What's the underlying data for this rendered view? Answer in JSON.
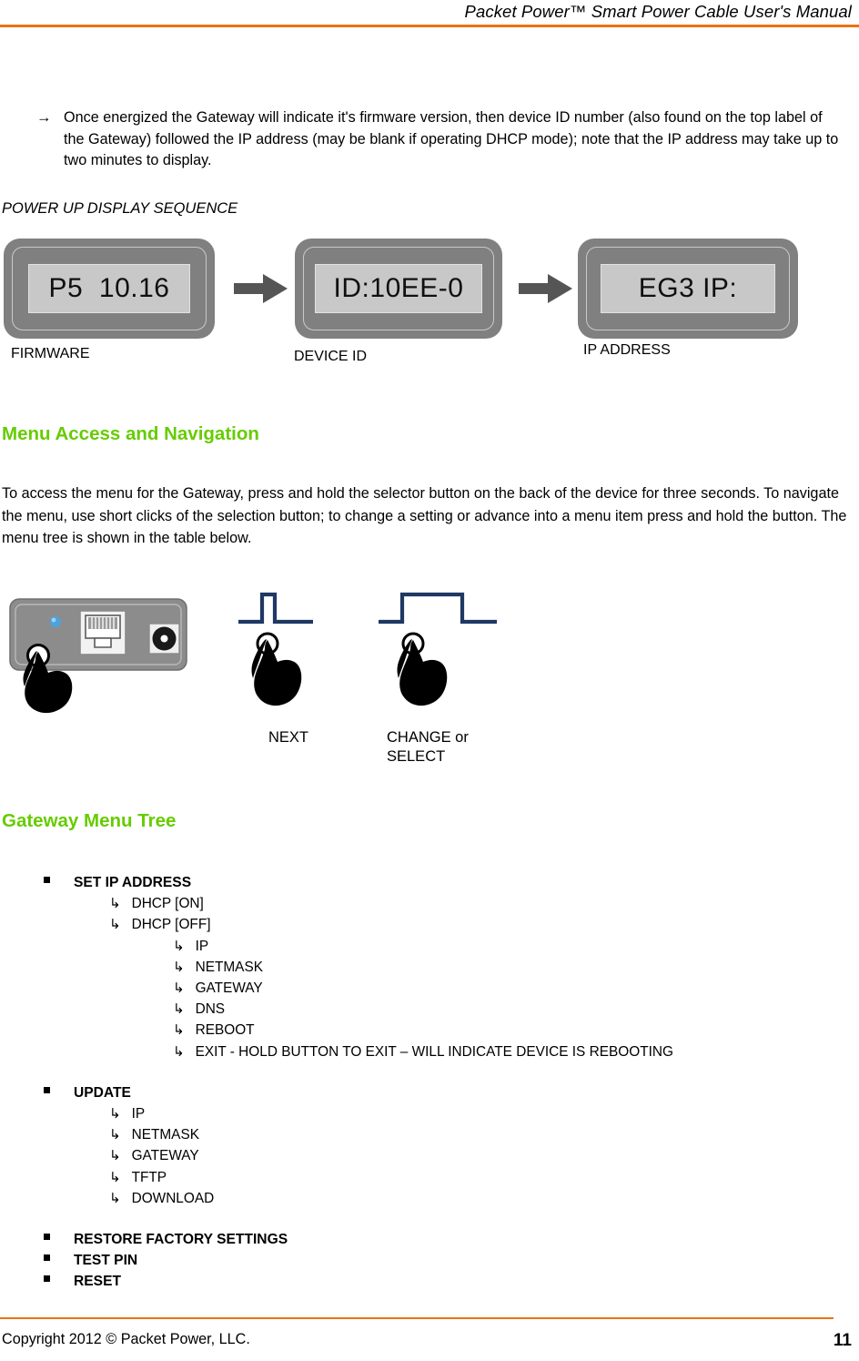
{
  "header": {
    "title": "Packet Power™ Smart Power Cable User's Manual",
    "rule_color": "#E8730C"
  },
  "intro": {
    "arrow_glyph": "→",
    "text": "Once energized the Gateway will indicate it's firmware version, then device ID number (also found on the top label of the Gateway) followed the IP address (may be blank if operating DHCP mode); note that the IP address may take up to two minutes to display."
  },
  "power_up_sequence": {
    "title": "POWER UP DISPLAY SEQUENCE",
    "displays": [
      {
        "screen_text": "P5  10.16",
        "caption": "FIRMWARE"
      },
      {
        "screen_text": "ID:10EE-0",
        "caption": "DEVICE ID"
      },
      {
        "screen_text": "EG3 IP:",
        "caption": "IP ADDRESS"
      }
    ],
    "arrow_color": "#555555",
    "bezel_color": "#808080",
    "screen_color": "#C8C8C8"
  },
  "menu_access": {
    "heading": "Menu Access and Navigation",
    "heading_color": "#66CC00",
    "paragraph": "To access the menu for the Gateway, press and hold the selector button on the back of the device for three seconds.  To navigate the menu, use short clicks of the selection button; to change a setting or advance into a menu item press and hold the button.  The menu tree is shown in the table below."
  },
  "figure": {
    "device": {
      "panel_color": "#8C8C8C",
      "led_color": "#4AA3DF",
      "port_label": "ethernet-jack",
      "power_label": "power-jack"
    },
    "gestures": [
      {
        "label": "NEXT",
        "pulse": "short",
        "pulse_color": "#1F3864"
      },
      {
        "label": "CHANGE or\nSELECT",
        "pulse": "long",
        "pulse_color": "#1F3864"
      }
    ],
    "gesture_labels": {
      "next": "NEXT",
      "select_line1": "CHANGE or",
      "select_line2": "SELECT"
    }
  },
  "menu_tree": {
    "heading": "Gateway Menu Tree",
    "heading_color": "#66CC00",
    "hook_glyph": "↳",
    "groups": [
      {
        "label": "SET IP ADDRESS",
        "children": [
          {
            "label": "DHCP [ON]",
            "level": 1
          },
          {
            "label": "DHCP [OFF]",
            "level": 1
          },
          {
            "label": "IP",
            "level": 2
          },
          {
            "label": "NETMASK",
            "level": 2
          },
          {
            "label": "GATEWAY",
            "level": 2
          },
          {
            "label": "DNS",
            "level": 2
          },
          {
            "label": "REBOOT",
            "level": 2
          },
          {
            "label": "EXIT  - HOLD BUTTON TO EXIT – WILL INDICATE DEVICE IS REBOOTING",
            "level": 2
          }
        ]
      },
      {
        "label": "UPDATE",
        "children": [
          {
            "label": "IP",
            "level": 1
          },
          {
            "label": "NETMASK",
            "level": 1
          },
          {
            "label": "GATEWAY",
            "level": 1
          },
          {
            "label": "TFTP",
            "level": 1
          },
          {
            "label": "DOWNLOAD",
            "level": 1
          }
        ]
      },
      {
        "label": "RESTORE FACTORY SETTINGS",
        "children": []
      },
      {
        "label": "TEST PIN",
        "children": []
      },
      {
        "label": "RESET",
        "children": []
      }
    ]
  },
  "footer": {
    "copyright": "Copyright 2012 © Packet Power, LLC.",
    "page_number": "11",
    "rule_color": "#E8730C"
  }
}
